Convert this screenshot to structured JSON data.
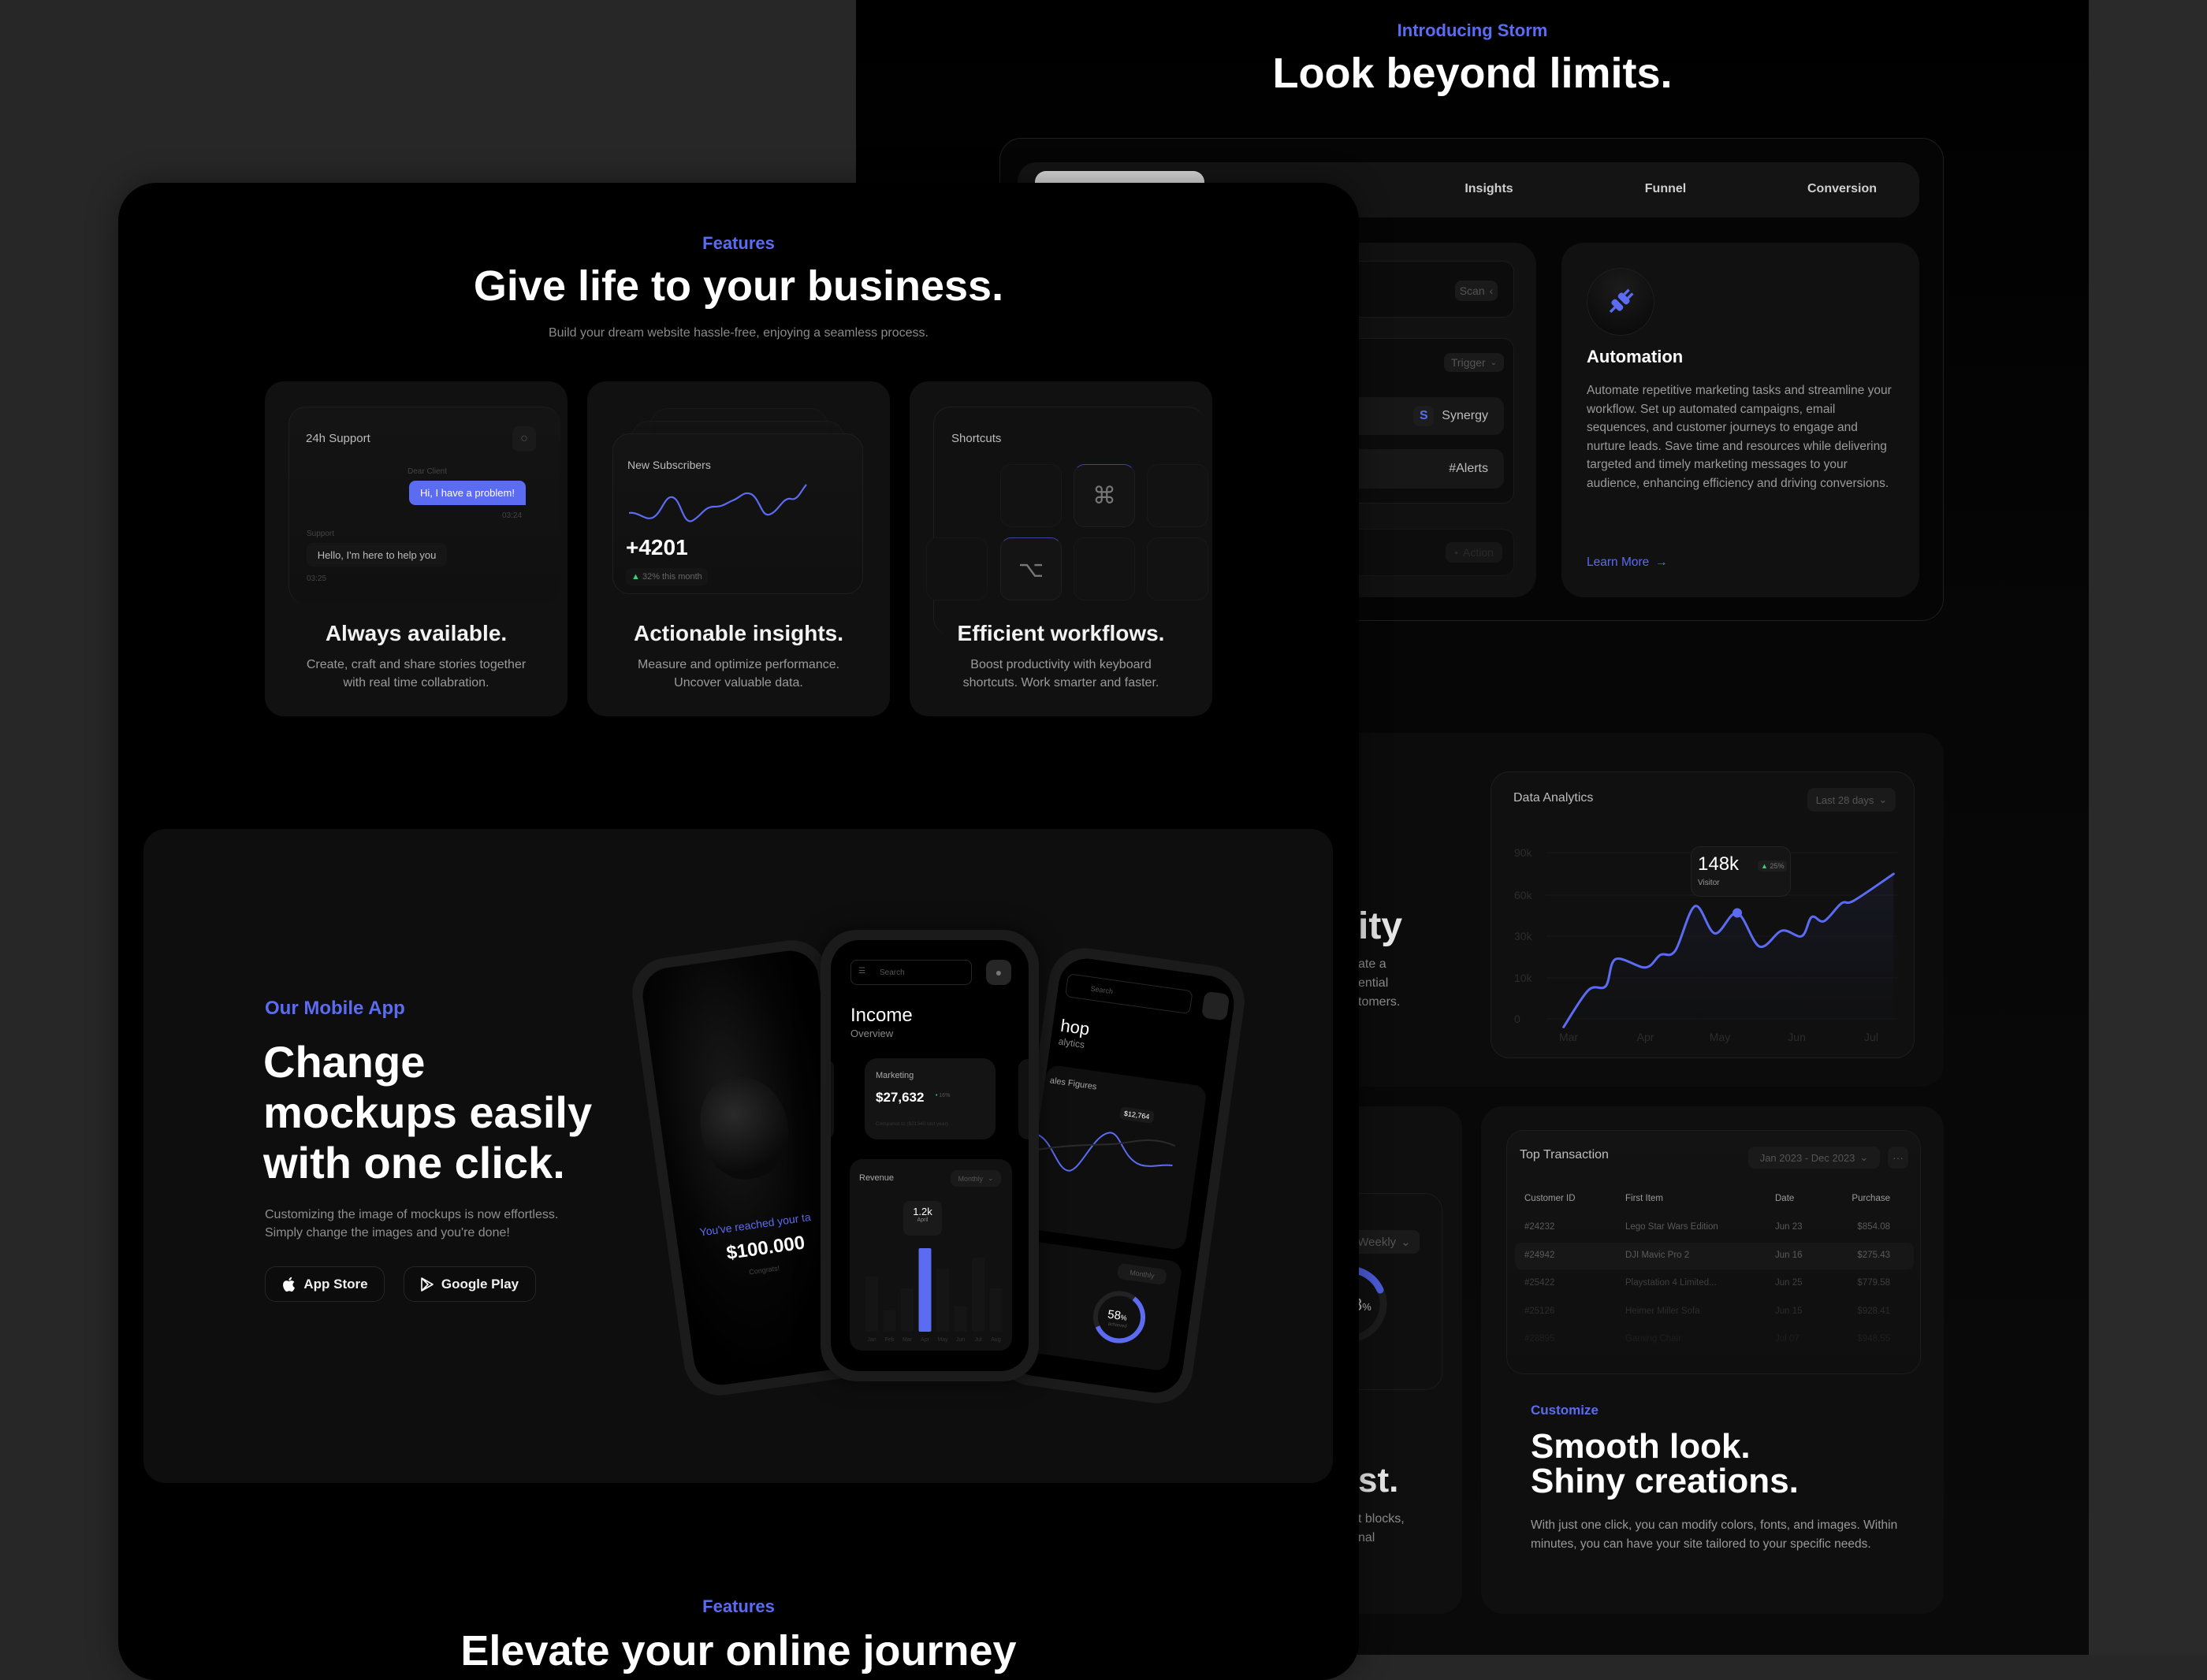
{
  "colors": {
    "accent": "#5b6cf2",
    "positive": "#3ecf7a",
    "background": "#000000",
    "card": "#111111"
  },
  "right_panel": {
    "intro_label": "Introducing Storm",
    "title": "Look beyond limits.",
    "tabs": [
      {
        "label": "Insights"
      },
      {
        "label": "Funnel"
      },
      {
        "label": "Conversion"
      }
    ],
    "workflow": {
      "scan": "Scan",
      "trigger": "Trigger",
      "synergy": "Synergy",
      "alerts": "#Alerts",
      "action": "Action"
    },
    "automation": {
      "icon": "plug-icon",
      "title": "Automation",
      "description": "Automate repetitive marketing tasks and streamline your workflow. Set up automated campaigns, email sequences, and customer journeys to engage and nurture leads. Save time and resources while delivering targeted and timely marketing messages to your audience, enhancing efficiency and driving conversions.",
      "link": "Learn More"
    },
    "analytics_partial": {
      "heading": "ity",
      "lines": [
        "ate a",
        "ential",
        "tomers."
      ]
    },
    "data_analytics": {
      "title": "Data Analytics",
      "range": "Last 28 days",
      "tooltip": {
        "value": "148k",
        "label": "Visitor",
        "change": "25%"
      }
    },
    "speed_partial": {
      "range": "Weekly",
      "percent": "8",
      "percent_sign": "%",
      "heading": "st.",
      "lines": [
        "t blocks,",
        "nal"
      ]
    },
    "transactions": {
      "title": "Top Transaction",
      "range": "Jan 2023 - Dec 2023",
      "columns": [
        "Customer ID",
        "First Item",
        "Date",
        "Purchase"
      ],
      "rows": [
        [
          "#24232",
          "Lego Star Wars Edition",
          "Jun 23",
          "$854.08"
        ],
        [
          "#24942",
          "DJI Mavic Pro 2",
          "Jun 16",
          "$275.43"
        ],
        [
          "#25422",
          "Playstation 4 Limited...",
          "Jun 25",
          "$779.58"
        ],
        [
          "#25126",
          "Heimer Miller Sofa",
          "Jun 15",
          "$928.41"
        ],
        [
          "#28895",
          "Gaming Chair",
          "Jul 07",
          "$948.55"
        ]
      ]
    },
    "customize": {
      "label": "Customize",
      "heading_lines": [
        "Smooth look.",
        "Shiny creations."
      ],
      "description": "With just one click, you can modify colors, fonts, and images. Within minutes, you can have your site tailored to your specific needs."
    }
  },
  "features": {
    "label": "Features",
    "title": "Give life to your business.",
    "subtitle": "Build your dream website hassle-free, enjoying a seamless process.",
    "cards": [
      {
        "title": "Always available.",
        "desc_lines": [
          "Create, craft and share stories together",
          "with real time collabration."
        ],
        "mock": {
          "header": "24h Support",
          "sender": "Dear Client",
          "message": "Hi, I have a problem!",
          "time1": "03:24",
          "responder": "Support",
          "reply": "Hello, I'm here to help you",
          "time2": "03:25"
        }
      },
      {
        "title": "Actionable insights.",
        "desc_lines": [
          "Measure and optimize performance.",
          "Uncover valuable data."
        ],
        "mock": {
          "header": "New Subscribers",
          "value": "+4201",
          "change": "32% this month"
        }
      },
      {
        "title": "Efficient workflows.",
        "desc_lines": [
          "Boost productivity with keyboard",
          "shortcuts. Work smarter and faster."
        ],
        "mock": {
          "header": "Shortcuts",
          "key1": "⌘",
          "key2": "⌥"
        }
      }
    ]
  },
  "mobile_app": {
    "label": "Our Mobile App",
    "heading_lines": [
      "Change",
      "mockups easily",
      "with one click."
    ],
    "desc_lines": [
      "Customizing the image of mockups is now effortless.",
      "Simply change the images and you're done!"
    ],
    "buttons": [
      {
        "label": "App Store",
        "icon": "apple-icon"
      },
      {
        "label": "Google Play",
        "icon": "google-play-icon"
      }
    ],
    "left_phone": {
      "message": "You've reached your ta",
      "amount": "$100.000",
      "note": "Congrats!"
    },
    "center_phone": {
      "search_placeholder": "Search",
      "title": "Income",
      "subtitle": "Overview",
      "marketing": {
        "label": "Marketing",
        "value": "$27,632",
        "change": "16%",
        "note": "Compared to ($21340 last year)"
      },
      "revenue": {
        "label": "Revenue",
        "period": "Monthly",
        "tooltip_value": "1.2k",
        "tooltip_label": "April"
      }
    },
    "right_phone": {
      "search_placeholder": "Search",
      "title": "hop",
      "subtitle": "alytics",
      "chart_title": "ales Figures",
      "tooltip": "$12,764",
      "period": "Monthly",
      "number": "1",
      "percent": "58",
      "percent_sign": "%",
      "percent_label": "achieved"
    }
  },
  "next_section": {
    "label": "Features",
    "title": "Elevate your online journey"
  },
  "chart_data": [
    {
      "type": "area",
      "title": "Data Analytics",
      "x_ticks": [
        "Mar",
        "Apr",
        "May",
        "Jun",
        "Jul"
      ],
      "y_ticks": [
        "0",
        "10k",
        "30k",
        "60k",
        "90k"
      ],
      "y_tick_values": [
        0,
        10,
        30,
        60,
        90
      ],
      "grid": true,
      "highlight_x": "May 8",
      "points": [
        {
          "x": "Feb 27",
          "y": -2
        },
        {
          "x": "Mar 9",
          "y": 7
        },
        {
          "x": "Mar 16",
          "y": 8
        },
        {
          "x": "Mar 20",
          "y": 19
        },
        {
          "x": "Apr 1",
          "y": 15
        },
        {
          "x": "Apr 7",
          "y": 21
        },
        {
          "x": "Apr 13",
          "y": 23
        },
        {
          "x": "Apr 21",
          "y": 52
        },
        {
          "x": "Apr 29",
          "y": 32
        },
        {
          "x": "May 8",
          "y": 47
        },
        {
          "x": "May 17",
          "y": 25
        },
        {
          "x": "May 26",
          "y": 34
        },
        {
          "x": "Jun 3",
          "y": 30
        },
        {
          "x": "Jun 7",
          "y": 44
        },
        {
          "x": "Jun 12",
          "y": 41
        },
        {
          "x": "Jun 19",
          "y": 54
        },
        {
          "x": "Jun 24",
          "y": 56
        },
        {
          "x": "Jul 10",
          "y": 75
        }
      ]
    },
    {
      "type": "bar",
      "title": "Revenue",
      "categories": [
        "Jan",
        "Feb",
        "Mar",
        "Apr",
        "May",
        "Jun",
        "Jul",
        "Aug"
      ],
      "values": [
        0.79,
        0.31,
        0.62,
        1.2,
        0.91,
        0.37,
        1.06,
        0.62
      ],
      "unit": "k",
      "highlight": "Apr"
    }
  ]
}
